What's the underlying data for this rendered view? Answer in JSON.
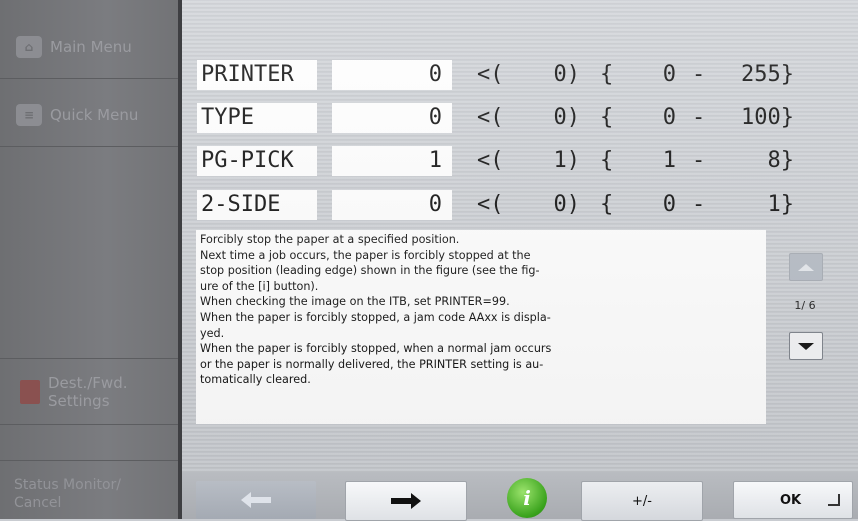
{
  "sidebar": {
    "main_menu": "Main Menu",
    "quick_menu": "Quick Menu",
    "dest_fwd": [
      "Dest./Fwd.",
      "Settings"
    ],
    "status_monitor": [
      "Status Monitor/",
      "Cancel"
    ]
  },
  "params": [
    {
      "name": "PRINTER",
      "value": "0",
      "default": "<(",
      "default_value": "0)",
      "range_open": "{",
      "min": "0",
      "dash": "-",
      "max": "255}"
    },
    {
      "name": "TYPE",
      "value": "0",
      "default": "<(",
      "default_value": "0)",
      "range_open": "{",
      "min": "0",
      "dash": "-",
      "max": "100}"
    },
    {
      "name": "PG-PICK",
      "value": "1",
      "default": "<(",
      "default_value": "1)",
      "range_open": "{",
      "min": "1",
      "dash": "-",
      "max": "8}"
    },
    {
      "name": "2-SIDE",
      "value": "0",
      "default": "<(",
      "default_value": "0)",
      "range_open": "{",
      "min": "0",
      "dash": "-",
      "max": "1}"
    }
  ],
  "description": [
    "Forcibly stop the paper at a specified position.",
    "Next time a job occurs, the paper is forcibly stopped at the",
    "stop position (leading edge) shown in the figure (see the fig-",
    "ure of the [i] button).",
    "When checking the image on the ITB, set PRINTER=99.",
    "When the paper is forcibly stopped, a jam code AAxx is displa-",
    "yed.",
    "When the paper is forcibly stopped, when a normal jam occurs",
    "or the paper is normally delivered, the PRINTER setting is au-",
    "tomatically cleared."
  ],
  "pager": {
    "label": "1/ 6"
  },
  "toolbar": {
    "back_icon": "left-arrow-icon",
    "next_icon": "right-arrow-icon",
    "info_label": "i",
    "plusminus_label": "+/-",
    "ok_label": "OK"
  },
  "colors": {
    "info_green": "#39a21c",
    "sidebar": "#76777a"
  }
}
